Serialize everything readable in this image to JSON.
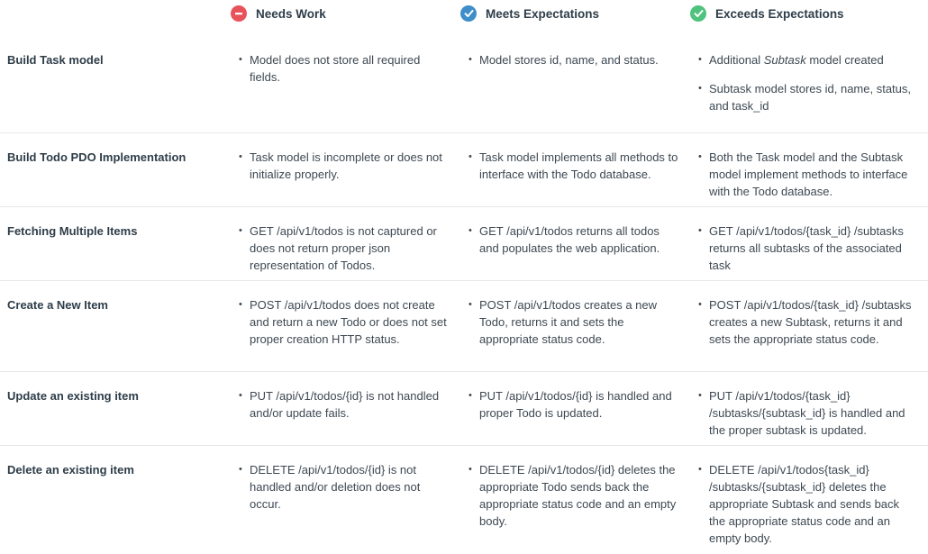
{
  "header": {
    "needs_work": {
      "label": "Needs Work",
      "icon": "minus-circle-icon",
      "color": "#e8535b"
    },
    "meets": {
      "label": "Meets Expectations",
      "icon": "check-circle-icon",
      "color": "#3f8ec9"
    },
    "exceeds": {
      "label": "Exceeds Expectations",
      "icon": "check-circle-icon",
      "color": "#4fc27d"
    }
  },
  "rows": [
    {
      "criterion": "Build Task model",
      "needs_work": [
        "Model does not store all required fields."
      ],
      "meets": [
        "Model stores id, name, and status."
      ],
      "exceeds": [
        "Additional Subtask model created",
        "Subtask model stores id, name, status, and task_id"
      ]
    },
    {
      "criterion": "Build Todo PDO Implementation",
      "needs_work": [
        "Task model is incomplete or does not initialize properly."
      ],
      "meets": [
        "Task model implements all methods to interface with the Todo database."
      ],
      "exceeds": [
        "Both the Task model and the Subtask model implement methods to interface with the Todo database."
      ]
    },
    {
      "criterion": "Fetching Multiple Items",
      "needs_work": [
        "GET /api/v1/todos is not captured or does not return proper json representation of Todos."
      ],
      "meets": [
        "GET /api/v1/todos returns all todos and populates the web application."
      ],
      "exceeds": [
        "GET /api/v1/todos/{task_id} /subtasks returns all subtasks of the associated task"
      ]
    },
    {
      "criterion": "Create a New Item",
      "needs_work": [
        "POST /api/v1/todos does not create and return a new Todo or does not set proper creation HTTP status."
      ],
      "meets": [
        "POST /api/v1/todos creates a new Todo, returns it and sets the appropriate status code."
      ],
      "exceeds": [
        "POST /api/v1/todos/{task_id} /subtasks creates a new Subtask, returns it and sets the appropriate status code."
      ]
    },
    {
      "criterion": "Update an existing item",
      "needs_work": [
        "PUT /api/v1/todos/{id} is not handled and/or update fails."
      ],
      "meets": [
        "PUT /api/v1/todos/{id} is handled and proper Todo is updated."
      ],
      "exceeds": [
        "PUT /api/v1/todos/{task_id} /subtasks/{subtask_id} is handled and the proper subtask is updated."
      ]
    },
    {
      "criterion": "Delete an existing item",
      "needs_work": [
        "DELETE /api/v1/todos/{id} is not handled and/or deletion does not occur."
      ],
      "meets": [
        "DELETE /api/v1/todos/{id} deletes the appropriate Todo sends back the appropriate status code and an empty body."
      ],
      "exceeds": [
        "DELETE /api/v1/todos{task_id} /subtasks/{subtask_id} deletes the appropriate Subtask and sends back the appropriate status code and an empty body."
      ]
    }
  ]
}
